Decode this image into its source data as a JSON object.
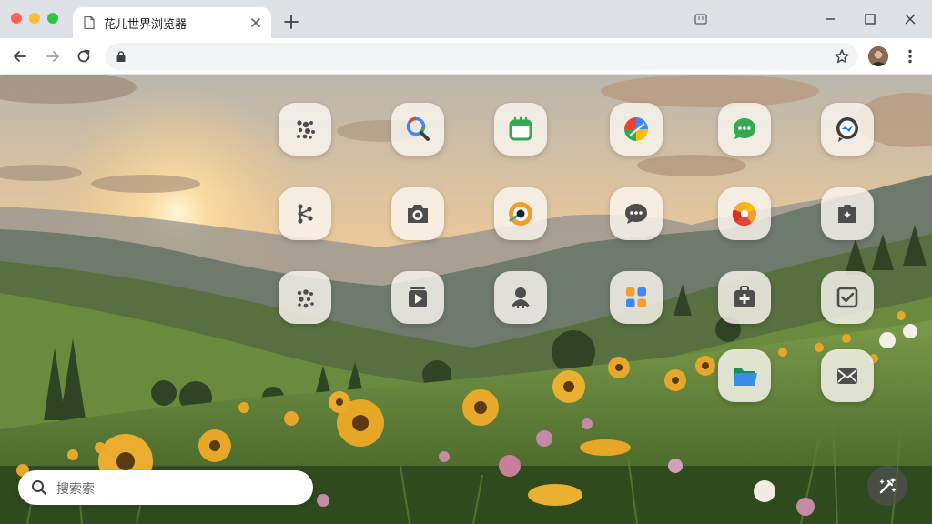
{
  "window": {
    "controls": [
      "close-dot",
      "minimize-dot",
      "zoom-dot"
    ],
    "colors": {
      "close": "#ff5f57",
      "minimize": "#febc2e",
      "zoom": "#28c840"
    }
  },
  "tab": {
    "title": "花儿世界浏览器",
    "icon": "document-icon"
  },
  "toolbar": {
    "url": ""
  },
  "search": {
    "placeholder": "搜索索"
  },
  "apps": [
    {
      "name": "app-dots-1",
      "icon": "dots-icon"
    },
    {
      "name": "app-search",
      "icon": "magnifier-icon"
    },
    {
      "name": "app-calendar",
      "icon": "calendar-icon"
    },
    {
      "name": "app-maps",
      "icon": "pie-icon"
    },
    {
      "name": "app-chat-green",
      "icon": "chat-icon"
    },
    {
      "name": "app-messenger",
      "icon": "messenger-icon"
    },
    {
      "name": "app-share",
      "icon": "share-icon"
    },
    {
      "name": "app-camera",
      "icon": "camera-icon"
    },
    {
      "name": "app-lens",
      "icon": "lens-icon"
    },
    {
      "name": "app-messages",
      "icon": "speech-icon"
    },
    {
      "name": "app-photos",
      "icon": "wheel-icon"
    },
    {
      "name": "app-gallery",
      "icon": "photo-icon"
    },
    {
      "name": "app-dots-2",
      "icon": "dots-icon"
    },
    {
      "name": "app-video",
      "icon": "play-icon"
    },
    {
      "name": "app-contacts",
      "icon": "person-icon"
    },
    {
      "name": "app-launcher",
      "icon": "grid-icon"
    },
    {
      "name": "app-health",
      "icon": "medkit-icon"
    },
    {
      "name": "app-tasks",
      "icon": "checkbox-icon"
    },
    {
      "name": "app-files",
      "icon": "folder-icon"
    },
    {
      "name": "app-mail",
      "icon": "envelope-icon"
    }
  ]
}
